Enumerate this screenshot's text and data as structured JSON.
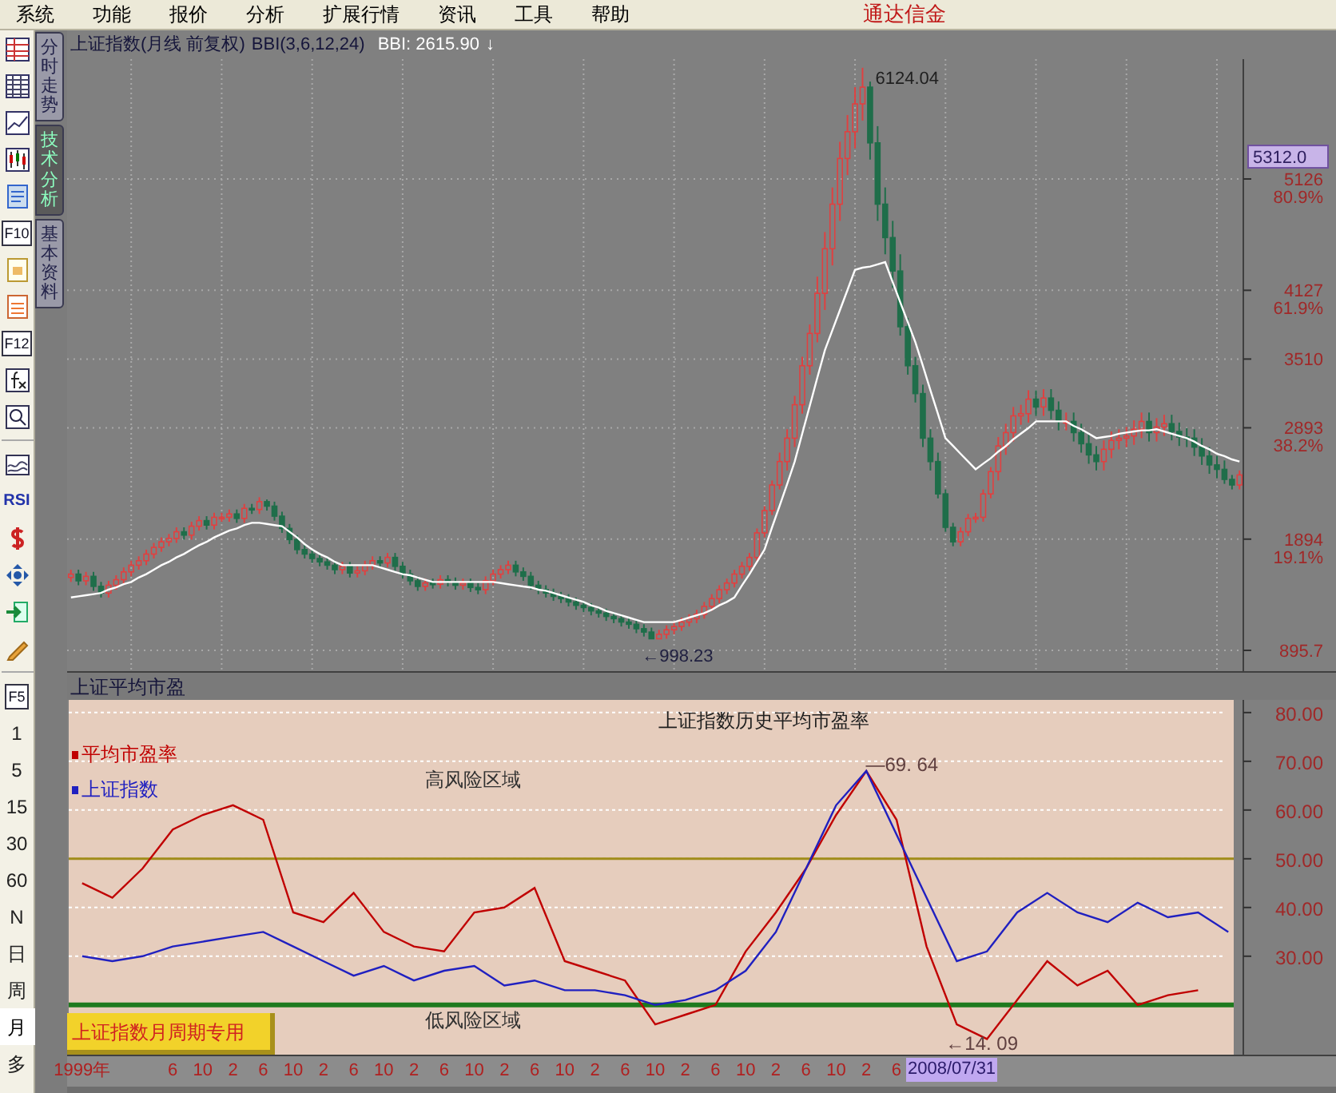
{
  "menu": {
    "items": [
      "系统",
      "功能",
      "报价",
      "分析",
      "扩展行情",
      "资讯",
      "工具",
      "帮助"
    ],
    "brand": "通达信金"
  },
  "toolbar": [
    {
      "kind": "icon"
    },
    {
      "kind": "icon"
    },
    {
      "kind": "icon"
    },
    {
      "kind": "icon"
    },
    {
      "kind": "icon"
    },
    {
      "kind": "key",
      "label": "F10"
    },
    {
      "kind": "icon"
    },
    {
      "kind": "icon"
    },
    {
      "kind": "key",
      "label": "F12"
    },
    {
      "kind": "icon"
    },
    {
      "kind": "icon"
    },
    {
      "kind": "divider"
    },
    {
      "kind": "icon"
    },
    {
      "kind": "text",
      "label": "RSI"
    },
    {
      "kind": "icon"
    },
    {
      "kind": "icon"
    },
    {
      "kind": "icon"
    },
    {
      "kind": "icon"
    },
    {
      "kind": "divider"
    },
    {
      "kind": "key",
      "label": "F5"
    }
  ],
  "periods": [
    {
      "label": "1",
      "selected": false
    },
    {
      "label": "5",
      "selected": false
    },
    {
      "label": "15",
      "selected": false
    },
    {
      "label": "30",
      "selected": false
    },
    {
      "label": "60",
      "selected": false
    },
    {
      "label": "N",
      "selected": false
    },
    {
      "label": "日",
      "selected": false
    },
    {
      "label": "周",
      "selected": false
    },
    {
      "label": "月",
      "selected": true
    },
    {
      "label": "多",
      "selected": false
    }
  ],
  "side_tabs": [
    {
      "label": "分时走势",
      "selected": false
    },
    {
      "label": "技术分析",
      "selected": true
    },
    {
      "label": "基本资料",
      "selected": false
    }
  ],
  "price_chart": {
    "title": "上证指数(月线 前复权)",
    "reading": "BBI: 2615.90",
    "trend": "↓",
    "cursor_price": "5312.0",
    "high_label": "6124.04",
    "low_label": "←998.23",
    "ratio_labels": [
      "80.9%",
      "61.9%",
      "38.2%",
      "19.1%"
    ],
    "chart_data": {
      "type": "candlestick",
      "grid": true,
      "categories": [
        null,
        null,
        null,
        null,
        null,
        null,
        null,
        null,
        null,
        null,
        null,
        null,
        null,
        null,
        null,
        null,
        null,
        null,
        null,
        null,
        null,
        null,
        null,
        null,
        null,
        null,
        null,
        null,
        null,
        null,
        null,
        null,
        null,
        null,
        null,
        null,
        null,
        null,
        null,
        null,
        null,
        null,
        null,
        null,
        null,
        null,
        null,
        null,
        null,
        null,
        null,
        null,
        null,
        null,
        null,
        null,
        null,
        null,
        null,
        null,
        null,
        null,
        null,
        null,
        null,
        null,
        null,
        null,
        null,
        null,
        null,
        null,
        null,
        null,
        null,
        null,
        null,
        null,
        null,
        null,
        null,
        null,
        null,
        null,
        null,
        null,
        null,
        null,
        null,
        null,
        null,
        null,
        null,
        null,
        null,
        null,
        null,
        null,
        null,
        null,
        null,
        null,
        null,
        null,
        null,
        null,
        null,
        null,
        null,
        null,
        null,
        null,
        null,
        null,
        null,
        null,
        null,
        null,
        null,
        null,
        null,
        null,
        null,
        null,
        null,
        null,
        null,
        null,
        null,
        null,
        null,
        null,
        null,
        null,
        null,
        null,
        null,
        null,
        null,
        null,
        null,
        null,
        null,
        null,
        null,
        null,
        null,
        null,
        null,
        null,
        null,
        null,
        null,
        null,
        null,
        null
      ],
      "ohlc": [
        [
          1550,
          1620,
          1510,
          1580
        ],
        [
          1580,
          1620,
          1480,
          1520
        ],
        [
          1520,
          1600,
          1480,
          1560
        ],
        [
          1560,
          1600,
          1430,
          1470
        ],
        [
          1470,
          1510,
          1370,
          1410
        ],
        [
          1410,
          1520,
          1370,
          1480
        ],
        [
          1480,
          1570,
          1440,
          1530
        ],
        [
          1530,
          1640,
          1490,
          1600
        ],
        [
          1600,
          1700,
          1560,
          1660
        ],
        [
          1660,
          1740,
          1620,
          1700
        ],
        [
          1700,
          1800,
          1660,
          1760
        ],
        [
          1760,
          1860,
          1720,
          1820
        ],
        [
          1820,
          1910,
          1780,
          1870
        ],
        [
          1870,
          1940,
          1830,
          1900
        ],
        [
          1900,
          2000,
          1860,
          1960
        ],
        [
          1960,
          2000,
          1890,
          1930
        ],
        [
          1930,
          2050,
          1890,
          2010
        ],
        [
          2010,
          2100,
          1970,
          2060
        ],
        [
          2060,
          2100,
          1980,
          2020
        ],
        [
          2020,
          2130,
          1980,
          2090
        ],
        [
          2090,
          2130,
          2050,
          2090
        ],
        [
          2090,
          2160,
          2050,
          2120
        ],
        [
          2120,
          2160,
          2040,
          2080
        ],
        [
          2080,
          2210,
          2040,
          2170
        ],
        [
          2170,
          2210,
          2120,
          2160
        ],
        [
          2160,
          2270,
          2120,
          2230
        ],
        [
          2230,
          2250,
          2150,
          2190
        ],
        [
          2190,
          2230,
          2060,
          2100
        ],
        [
          2100,
          2140,
          1950,
          1990
        ],
        [
          1990,
          2030,
          1850,
          1890
        ],
        [
          1890,
          1930,
          1760,
          1800
        ],
        [
          1800,
          1840,
          1720,
          1760
        ],
        [
          1760,
          1800,
          1680,
          1720
        ],
        [
          1720,
          1760,
          1650,
          1690
        ],
        [
          1690,
          1730,
          1620,
          1660
        ],
        [
          1660,
          1700,
          1580,
          1620
        ],
        [
          1620,
          1690,
          1580,
          1650
        ],
        [
          1650,
          1690,
          1550,
          1590
        ],
        [
          1590,
          1650,
          1550,
          1610
        ],
        [
          1610,
          1700,
          1570,
          1660
        ],
        [
          1660,
          1740,
          1620,
          1700
        ],
        [
          1700,
          1740,
          1640,
          1680
        ],
        [
          1680,
          1770,
          1640,
          1730
        ],
        [
          1730,
          1770,
          1610,
          1650
        ],
        [
          1650,
          1690,
          1540,
          1580
        ],
        [
          1580,
          1620,
          1480,
          1520
        ],
        [
          1520,
          1560,
          1430,
          1470
        ],
        [
          1470,
          1540,
          1430,
          1500
        ],
        [
          1500,
          1540,
          1450,
          1490
        ],
        [
          1490,
          1570,
          1450,
          1530
        ],
        [
          1530,
          1570,
          1470,
          1510
        ],
        [
          1510,
          1550,
          1440,
          1480
        ],
        [
          1480,
          1540,
          1440,
          1500
        ],
        [
          1500,
          1540,
          1420,
          1460
        ],
        [
          1460,
          1500,
          1400,
          1440
        ],
        [
          1440,
          1560,
          1400,
          1520
        ],
        [
          1520,
          1620,
          1480,
          1580
        ],
        [
          1580,
          1660,
          1540,
          1620
        ],
        [
          1620,
          1700,
          1580,
          1660
        ],
        [
          1660,
          1700,
          1560,
          1600
        ],
        [
          1600,
          1640,
          1520,
          1560
        ],
        [
          1560,
          1600,
          1440,
          1480
        ],
        [
          1480,
          1520,
          1400,
          1440
        ],
        [
          1440,
          1480,
          1370,
          1410
        ],
        [
          1410,
          1450,
          1340,
          1380
        ],
        [
          1380,
          1420,
          1320,
          1360
        ],
        [
          1360,
          1400,
          1290,
          1330
        ],
        [
          1330,
          1370,
          1260,
          1300
        ],
        [
          1300,
          1340,
          1240,
          1280
        ],
        [
          1280,
          1320,
          1210,
          1250
        ],
        [
          1250,
          1290,
          1190,
          1230
        ],
        [
          1230,
          1270,
          1160,
          1200
        ],
        [
          1200,
          1240,
          1140,
          1180
        ],
        [
          1180,
          1220,
          1110,
          1150
        ],
        [
          1150,
          1190,
          1090,
          1130
        ],
        [
          1130,
          1170,
          1050,
          1090
        ],
        [
          1090,
          1130,
          1020,
          1060
        ],
        [
          1060,
          1100,
          998,
          1000
        ],
        [
          1000,
          1080,
          1000,
          1040
        ],
        [
          1040,
          1120,
          1000,
          1080
        ],
        [
          1080,
          1150,
          1040,
          1110
        ],
        [
          1110,
          1190,
          1070,
          1150
        ],
        [
          1150,
          1220,
          1110,
          1180
        ],
        [
          1180,
          1260,
          1140,
          1220
        ],
        [
          1220,
          1330,
          1180,
          1290
        ],
        [
          1290,
          1400,
          1250,
          1360
        ],
        [
          1360,
          1480,
          1320,
          1440
        ],
        [
          1440,
          1540,
          1400,
          1500
        ],
        [
          1500,
          1620,
          1460,
          1580
        ],
        [
          1580,
          1690,
          1540,
          1650
        ],
        [
          1650,
          1770,
          1610,
          1730
        ],
        [
          1730,
          1990,
          1690,
          1950
        ],
        [
          1950,
          2190,
          1910,
          2150
        ],
        [
          2150,
          2420,
          2110,
          2380
        ],
        [
          2380,
          2670,
          2340,
          2590
        ],
        [
          2590,
          2880,
          2510,
          2800
        ],
        [
          2800,
          3180,
          2720,
          3100
        ],
        [
          3100,
          3530,
          3020,
          3450
        ],
        [
          3450,
          3820,
          3370,
          3740
        ],
        [
          3740,
          4250,
          3660,
          4100
        ],
        [
          4100,
          4650,
          3950,
          4500
        ],
        [
          4500,
          5050,
          4350,
          4900
        ],
        [
          4900,
          5460,
          4750,
          5310
        ],
        [
          5310,
          5700,
          5160,
          5550
        ],
        [
          5550,
          5950,
          5400,
          5800
        ],
        [
          5800,
          6124,
          5650,
          5950
        ],
        [
          5950,
          6000,
          5300,
          5450
        ],
        [
          5450,
          5600,
          4750,
          4900
        ],
        [
          4900,
          5050,
          4450,
          4600
        ],
        [
          4600,
          4750,
          4150,
          4300
        ],
        [
          4300,
          4450,
          3720,
          3800
        ],
        [
          3800,
          3880,
          3370,
          3450
        ],
        [
          3450,
          3530,
          3120,
          3200
        ],
        [
          3200,
          3280,
          2720,
          2800
        ],
        [
          2800,
          2880,
          2510,
          2590
        ],
        [
          2590,
          2670,
          2260,
          2300
        ],
        [
          2300,
          2340,
          1960,
          2000
        ],
        [
          2000,
          2040,
          1830,
          1870
        ],
        [
          1870,
          2000,
          1830,
          1960
        ],
        [
          1960,
          2120,
          1920,
          2080
        ],
        [
          2080,
          2130,
          2040,
          2090
        ],
        [
          2090,
          2340,
          2050,
          2300
        ],
        [
          2300,
          2540,
          2260,
          2500
        ],
        [
          2500,
          2810,
          2420,
          2730
        ],
        [
          2730,
          2930,
          2650,
          2850
        ],
        [
          2850,
          3080,
          2770,
          3000
        ],
        [
          3000,
          3100,
          2920,
          3020
        ],
        [
          3020,
          3230,
          2940,
          3150
        ],
        [
          3150,
          3230,
          3000,
          3080
        ],
        [
          3080,
          3240,
          3000,
          3160
        ],
        [
          3160,
          3240,
          2970,
          3050
        ],
        [
          3050,
          3130,
          2870,
          2950
        ],
        [
          2950,
          3030,
          2870,
          2950
        ],
        [
          2950,
          3030,
          2770,
          2850
        ],
        [
          2850,
          2930,
          2670,
          2750
        ],
        [
          2750,
          2830,
          2570,
          2650
        ],
        [
          2650,
          2730,
          2510,
          2590
        ],
        [
          2590,
          2780,
          2510,
          2700
        ],
        [
          2700,
          2860,
          2620,
          2780
        ],
        [
          2780,
          2880,
          2700,
          2800
        ],
        [
          2800,
          2900,
          2720,
          2820
        ],
        [
          2820,
          2960,
          2740,
          2880
        ],
        [
          2880,
          3030,
          2800,
          2950
        ],
        [
          2950,
          3030,
          2770,
          2850
        ],
        [
          2850,
          2980,
          2770,
          2900
        ],
        [
          2900,
          3010,
          2820,
          2930
        ],
        [
          2930,
          3010,
          2780,
          2860
        ],
        [
          2860,
          2940,
          2730,
          2810
        ],
        [
          2810,
          2890,
          2720,
          2800
        ],
        [
          2800,
          2880,
          2640,
          2720
        ],
        [
          2720,
          2800,
          2560,
          2640
        ],
        [
          2640,
          2720,
          2480,
          2560
        ],
        [
          2560,
          2640,
          2440,
          2520
        ],
        [
          2520,
          2600,
          2390,
          2430
        ],
        [
          2430,
          2470,
          2340,
          2380
        ],
        [
          2380,
          2510,
          2340,
          2470
        ]
      ],
      "series": [
        {
          "name": "BBI(3,6,12,24)",
          "type": "line",
          "color": "#ffffff",
          "values": [
            1370,
            1380,
            1390,
            1400,
            1410,
            1440,
            1460,
            1490,
            1510,
            1550,
            1580,
            1620,
            1660,
            1690,
            1730,
            1760,
            1800,
            1840,
            1870,
            1910,
            1940,
            1970,
            1990,
            2020,
            2040,
            2040,
            2030,
            2020,
            2010,
            1960,
            1910,
            1850,
            1800,
            1760,
            1730,
            1690,
            1660,
            1660,
            1660,
            1660,
            1660,
            1640,
            1620,
            1600,
            1580,
            1570,
            1550,
            1530,
            1510,
            1510,
            1510,
            1510,
            1510,
            1510,
            1510,
            1510,
            1510,
            1500,
            1490,
            1480,
            1470,
            1460,
            1440,
            1430,
            1410,
            1390,
            1370,
            1350,
            1330,
            1300,
            1280,
            1250,
            1230,
            1210,
            1190,
            1170,
            1150,
            1150,
            1150,
            1150,
            1150,
            1170,
            1190,
            1210,
            1230,
            1260,
            1300,
            1330,
            1370,
            1480,
            1580,
            1690,
            1800,
            2000,
            2190,
            2390,
            2590,
            2840,
            3090,
            3340,
            3590,
            3770,
            3950,
            4130,
            4310,
            4330,
            4340,
            4360,
            4380,
            4200,
            4020,
            3840,
            3660,
            3450,
            3230,
            3020,
            2800,
            2730,
            2660,
            2590,
            2520,
            2570,
            2620,
            2680,
            2730,
            2790,
            2840,
            2890,
            2950,
            2950,
            2950,
            2950,
            2950,
            2910,
            2880,
            2840,
            2800,
            2810,
            2820,
            2840,
            2850,
            2860,
            2870,
            2870,
            2880,
            2860,
            2840,
            2820,
            2800,
            2770,
            2730,
            2700,
            2660,
            2640,
            2610,
            2590
          ]
        }
      ],
      "ylim": [
        709.3,
        6201.5
      ],
      "yticks": [
        {
          "value": 5126,
          "label": "5126"
        },
        {
          "value": 4127,
          "label": "4127"
        },
        {
          "value": 3510,
          "label": "3510"
        },
        {
          "value": 2893,
          "label": "2893"
        },
        {
          "value": 1894,
          "label": "1894"
        },
        {
          "value": 895.7,
          "label": "895.7"
        }
      ]
    }
  },
  "pe_panel": {
    "title": "上证平均市盈",
    "heading": "上证指数历史平均市盈率",
    "badge": "上证指数月周期专用",
    "cursor_date": "2008/07/31",
    "peak_label": "—69. 64",
    "trough_label": "←14. 09",
    "zone_labels": [
      "高风险区域",
      "低风险区域"
    ],
    "chart_data": {
      "type": "line",
      "grid": true,
      "legend": "upper left",
      "categories": [
        "1999年",
        null,
        null,
        "6",
        "10",
        "2",
        "6",
        "10",
        "2",
        "6",
        "10",
        "2",
        "6",
        "10",
        "2",
        "6",
        "10",
        "2",
        "6",
        "10",
        "2",
        "6",
        "10",
        "2",
        "6",
        "10",
        "2",
        "6",
        null,
        null,
        null,
        null,
        null,
        null,
        null,
        null,
        null,
        null,
        null
      ],
      "series": [
        {
          "name": "平均市盈率",
          "color": "#c00000",
          "values": [
            45,
            42,
            48,
            56,
            59,
            61,
            58,
            39,
            37,
            43,
            35,
            32,
            31,
            39,
            40,
            44,
            29,
            27,
            25,
            16,
            18,
            20,
            31,
            39,
            48,
            59,
            68,
            58,
            32,
            16,
            13,
            21,
            29,
            24,
            27,
            20,
            22,
            23,
            null
          ]
        },
        {
          "name": "上证指数",
          "color": "#2020c0",
          "values": [
            30,
            29,
            30,
            32,
            33,
            34,
            35,
            32,
            29,
            26,
            28,
            25,
            27,
            28,
            24,
            25,
            23,
            23,
            22,
            20,
            21,
            23,
            27,
            35,
            48,
            61,
            68,
            55,
            42,
            29,
            31,
            39,
            43,
            39,
            37,
            41,
            38,
            39,
            35
          ]
        }
      ],
      "ref_lines": [
        {
          "axis": "y",
          "value": 50,
          "color": "#a08c1a"
        },
        {
          "axis": "y",
          "value": 20,
          "color": "#1e7a1e"
        }
      ],
      "ylim": [
        9.8,
        82.6
      ],
      "yticks": [
        {
          "value": 80,
          "label": "80.00"
        },
        {
          "value": 70,
          "label": "70.00"
        },
        {
          "value": 60,
          "label": "60.00"
        },
        {
          "value": 50,
          "label": "50.00"
        },
        {
          "value": 40,
          "label": "40.00"
        },
        {
          "value": 30,
          "label": "30.00"
        }
      ]
    }
  }
}
